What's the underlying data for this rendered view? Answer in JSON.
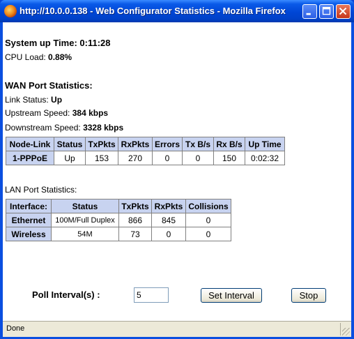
{
  "window": {
    "title": "http://10.0.0.138 - Web Configurator Statistics - Mozilla Firefox",
    "app_icon": "firefox-icon"
  },
  "system": {
    "uptime_label": "System up Time:",
    "uptime_value": "0:11:28",
    "cpu_label": "CPU Load:",
    "cpu_value": "0.88%"
  },
  "wan": {
    "heading": "WAN Port Statistics:",
    "link_label": "Link Status:",
    "link_value": "Up",
    "upstream_label": "Upstream Speed:",
    "upstream_value": "384 kbps",
    "downstream_label": "Downstream Speed:",
    "downstream_value": "3328 kbps",
    "columns": [
      "Node-Link",
      "Status",
      "TxPkts",
      "RxPkts",
      "Errors",
      "Tx B/s",
      "Rx B/s",
      "Up Time"
    ],
    "rows": [
      [
        "1-PPPoE",
        "Up",
        "153",
        "270",
        "0",
        "0",
        "150",
        "0:02:32"
      ]
    ]
  },
  "lan": {
    "heading": "LAN Port Statistics:",
    "columns": [
      "Interface:",
      "Status",
      "TxPkts",
      "RxPkts",
      "Collisions"
    ],
    "rows": [
      [
        "Ethernet",
        "100M/Full Duplex",
        "866",
        "845",
        "0"
      ],
      [
        "Wireless",
        "54M",
        "73",
        "0",
        "0"
      ]
    ]
  },
  "poll": {
    "label": "Poll Interval(s) :",
    "value": "5",
    "set_button": "Set Interval",
    "stop_button": "Stop"
  },
  "statusbar": {
    "text": "Done"
  }
}
